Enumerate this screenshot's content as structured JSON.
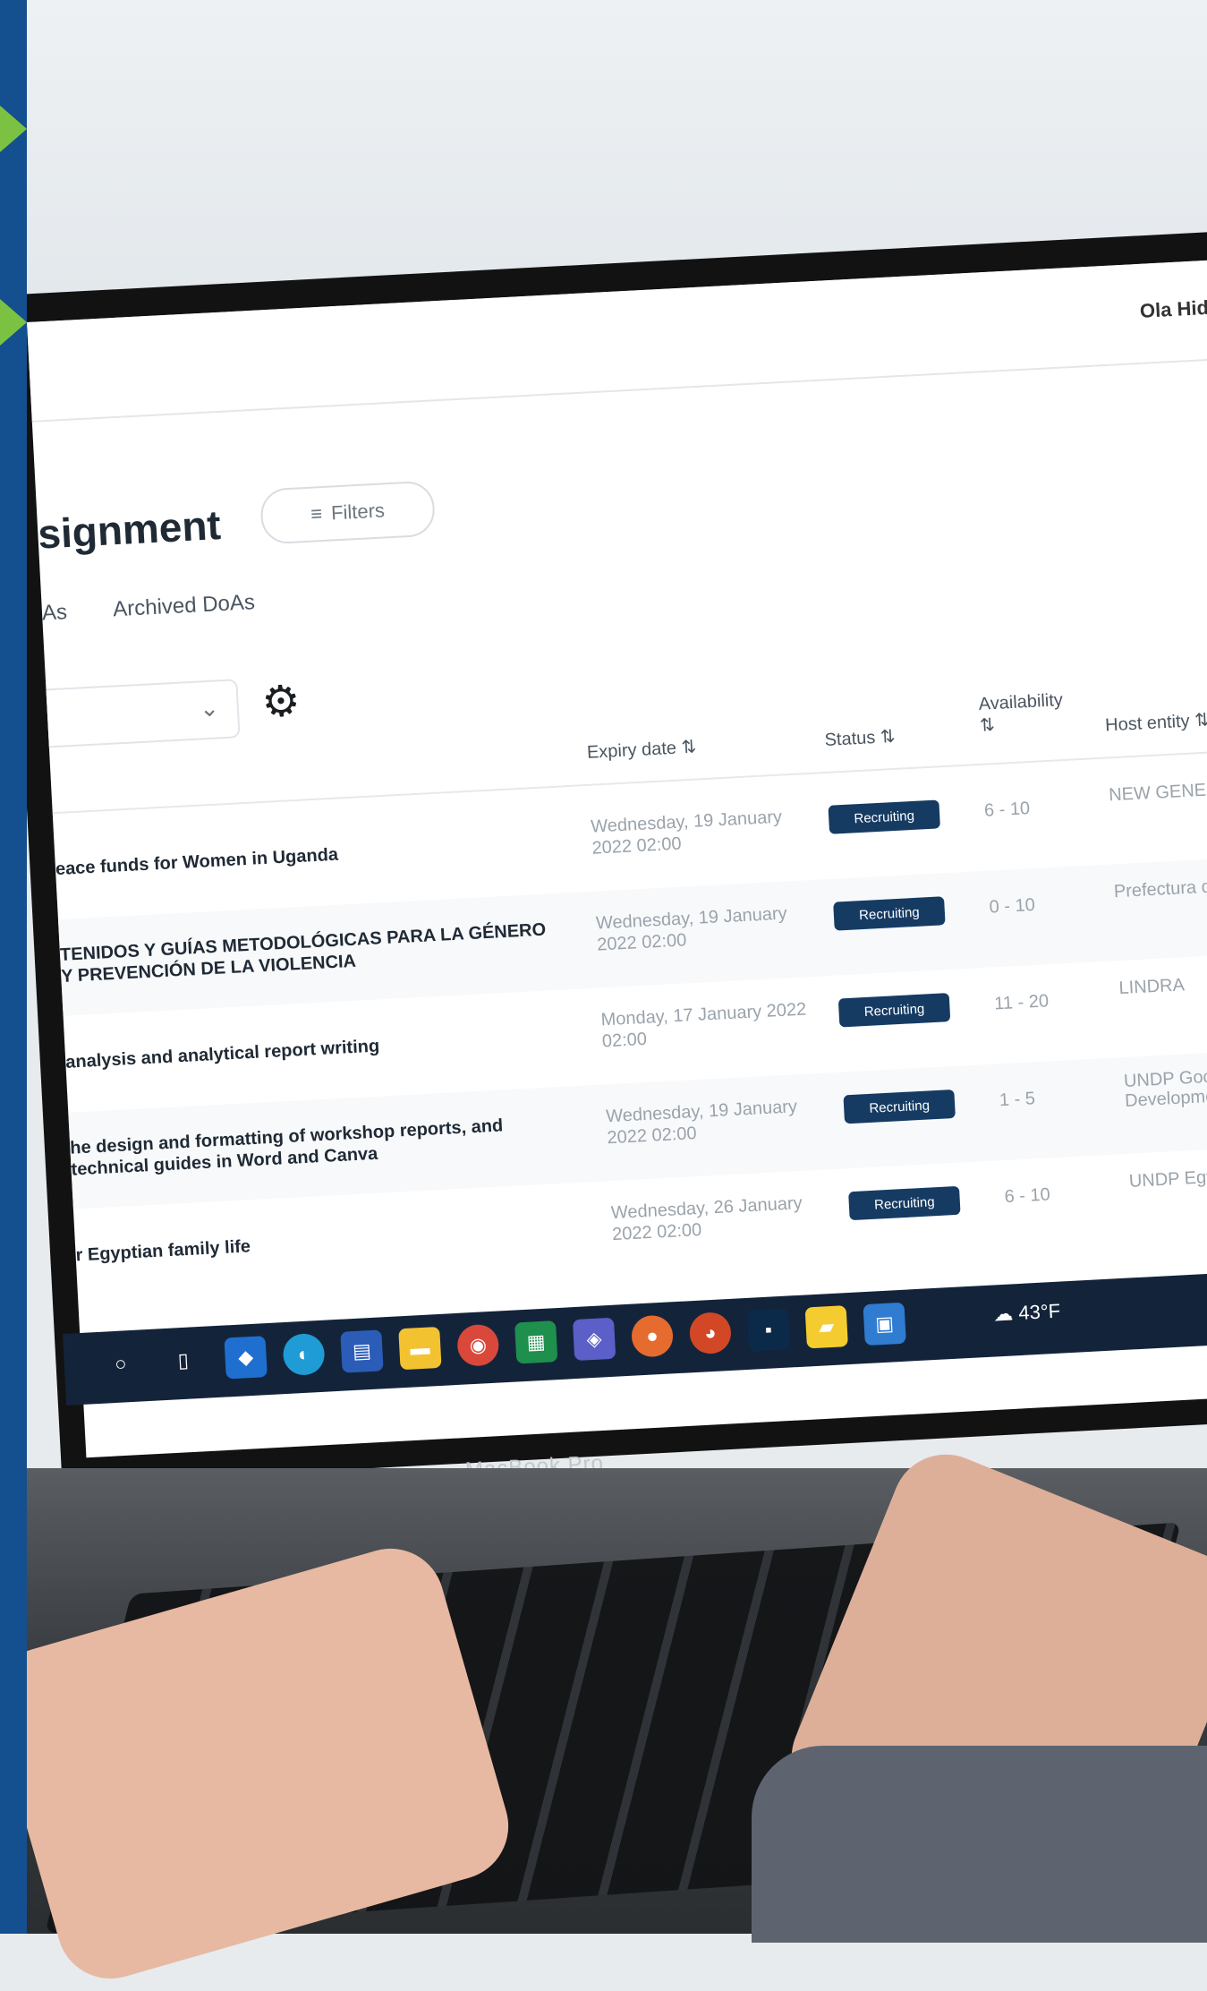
{
  "header": {
    "user_name": "Ola Hid"
  },
  "page": {
    "title": "signment",
    "filters_label": "Filters",
    "tabs": [
      {
        "label": "As"
      },
      {
        "label": "Archived DoAs"
      }
    ]
  },
  "table": {
    "columns": {
      "expiry": "Expiry date",
      "status": "Status",
      "availability": "Availability",
      "host": "Host entity"
    },
    "rows": [
      {
        "title": "eace funds for Women in Uganda",
        "date": "Wednesday, 19 January 2022 02:00",
        "status": "Recruiting",
        "availability": "6 - 10",
        "host": "NEW GENERA"
      },
      {
        "title": "TENIDOS Y GUÍAS METODOLÓGICAS PARA LA GÉNERO Y PREVENCIÓN DE LA VIOLENCIA",
        "date": "Wednesday, 19 January 2022 02:00",
        "status": "Recruiting",
        "availability": "0 - 10",
        "host": "Prefectura de"
      },
      {
        "title": "analysis and analytical report writing",
        "date": "Monday, 17 January 2022 02:00",
        "status": "Recruiting",
        "availability": "11 - 20",
        "host": "LINDRA"
      },
      {
        "title": "he design and formatting of workshop reports, and technical guides in Word and Canva",
        "date": "Wednesday, 19 January 2022 02:00",
        "status": "Recruiting",
        "availability": "1 - 5",
        "host": "UNDP Good to Developme"
      },
      {
        "title": "r Egyptian family life",
        "date": "Wednesday, 26 January 2022 02:00",
        "status": "Recruiting",
        "availability": "6 - 10",
        "host": "UNDP Egypt"
      }
    ]
  },
  "taskbar": {
    "weather": "43°F"
  },
  "device": {
    "label": "MacBook Pro"
  }
}
